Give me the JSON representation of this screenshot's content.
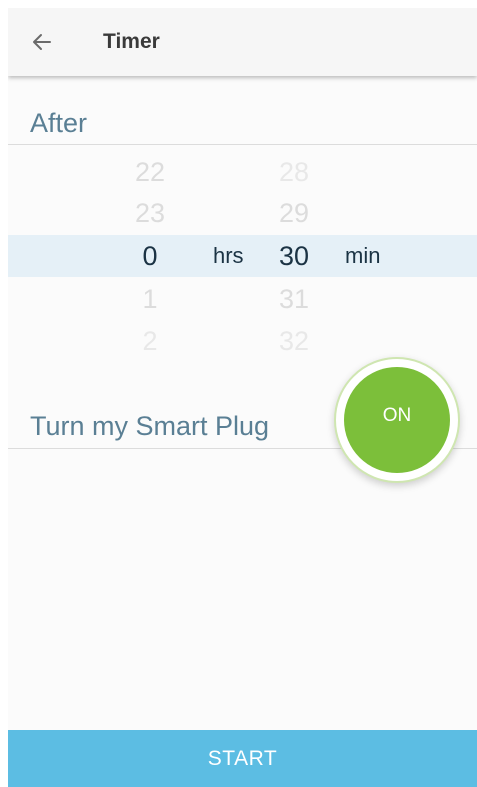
{
  "header": {
    "title": "Timer",
    "back_icon": "arrow-left-icon"
  },
  "after": {
    "label": "After"
  },
  "picker": {
    "hours": {
      "above2": "22",
      "above1": "23",
      "selected": "0",
      "below1": "1",
      "below2": "2",
      "unit": "hrs"
    },
    "minutes": {
      "above2": "28",
      "above1": "29",
      "selected": "30",
      "below1": "31",
      "below2": "32",
      "unit": "min"
    }
  },
  "smart_plug": {
    "label": "Turn my Smart Plug",
    "toggle": "ON"
  },
  "footer": {
    "start_label": "START"
  },
  "colors": {
    "accent_blue": "#5cbde3",
    "toggle_green": "#7cbf3a",
    "label_blue": "#5a7f94",
    "selected_row": "#e5f0f7"
  }
}
